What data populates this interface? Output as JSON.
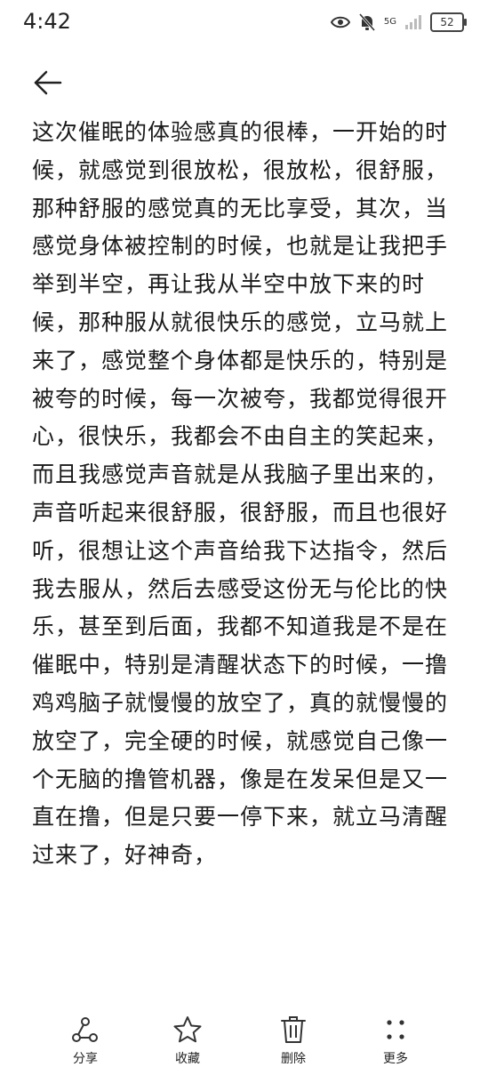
{
  "status_bar": {
    "time": "4:42",
    "network": "5G",
    "battery": "52",
    "icons": [
      "eye-icon",
      "mute-bell-icon",
      "signal-icon",
      "battery-icon"
    ]
  },
  "nav": {
    "back_icon": "arrow-left-icon"
  },
  "content": {
    "text": "这次催眠的体验感真的很棒，一开始的时候，就感觉到很放松，很放松，很舒服，那种舒服的感觉真的无比享受，其次，当感觉身体被控制的时候，也就是让我把手举到半空，再让我从半空中放下来的时候，那种服从就很快乐的感觉，立马就上来了，感觉整个身体都是快乐的，特别是被夸的时候，每一次被夸，我都觉得很开心，很快乐，我都会不由自主的笑起来，而且我感觉声音就是从我脑子里出来的，声音听起来很舒服，很舒服，而且也很好听，很想让这个声音给我下达指令，然后我去服从，然后去感受这份无与伦比的快乐，甚至到后面，我都不知道我是不是在催眠中，特别是清醒状态下的时候，一撸鸡鸡脑子就慢慢的放空了，真的就慢慢的放空了，完全硬的时候，就感觉自己像一个无脑的撸管机器，像是在发呆但是又一直在撸，但是只要一停下来，就立马清醒过来了，好神奇，"
  },
  "bottom_bar": {
    "share": {
      "label": "分享",
      "icon": "share-icon"
    },
    "favorite": {
      "label": "收藏",
      "icon": "star-icon"
    },
    "delete": {
      "label": "删除",
      "icon": "trash-icon"
    },
    "more": {
      "label": "更多",
      "icon": "more-dots-icon"
    }
  }
}
